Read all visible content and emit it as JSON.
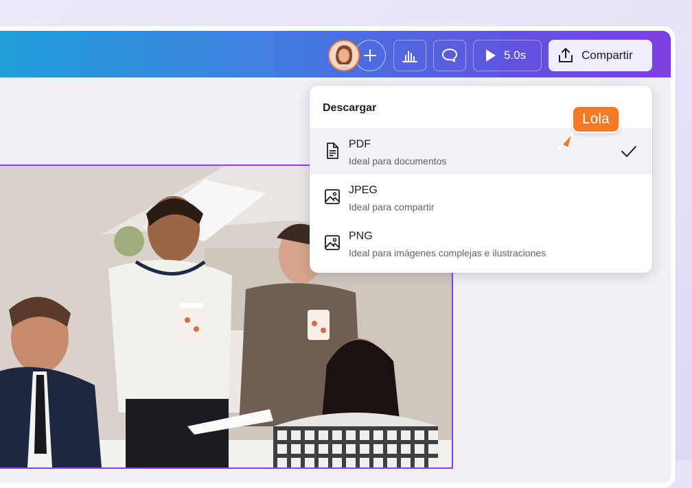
{
  "toolbar": {
    "add_label": "+",
    "play_duration": "5.0s",
    "share_label": "Compartir"
  },
  "download_menu": {
    "title": "Descargar",
    "options": [
      {
        "title": "PDF",
        "subtitle": "Ideal para documentos",
        "icon": "document-icon",
        "selected": true
      },
      {
        "title": "JPEG",
        "subtitle": "Ideal para compartir",
        "icon": "image-icon",
        "selected": false
      },
      {
        "title": "PNG",
        "subtitle": "Ideal para imágenes complejas e ilustraciones",
        "icon": "image-icon",
        "selected": false
      }
    ]
  },
  "collaborator_cursor": {
    "name": "Lola",
    "color": "#f47a25"
  },
  "colors": {
    "accent_purple": "#8b3dff",
    "topbar_gradient": [
      "#1fa0d8",
      "#7d3fe1"
    ]
  }
}
